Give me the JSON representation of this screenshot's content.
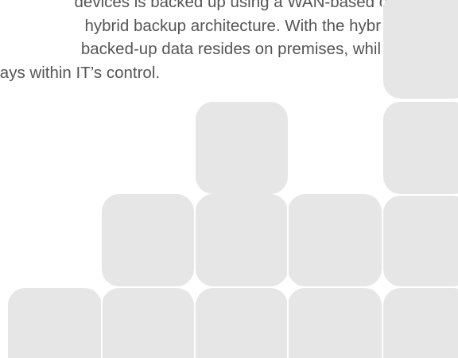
{
  "paragraph": {
    "lines": [
      "devices is backed up using a WAN-based or",
      "hybrid backup architecture. With the hybrid",
      "backed-up data resides on premises, whilst",
      "ways within IT’s control."
    ]
  },
  "colors": {
    "text": "#555555",
    "block": "#e6e6e6",
    "background": "#ffffff"
  }
}
